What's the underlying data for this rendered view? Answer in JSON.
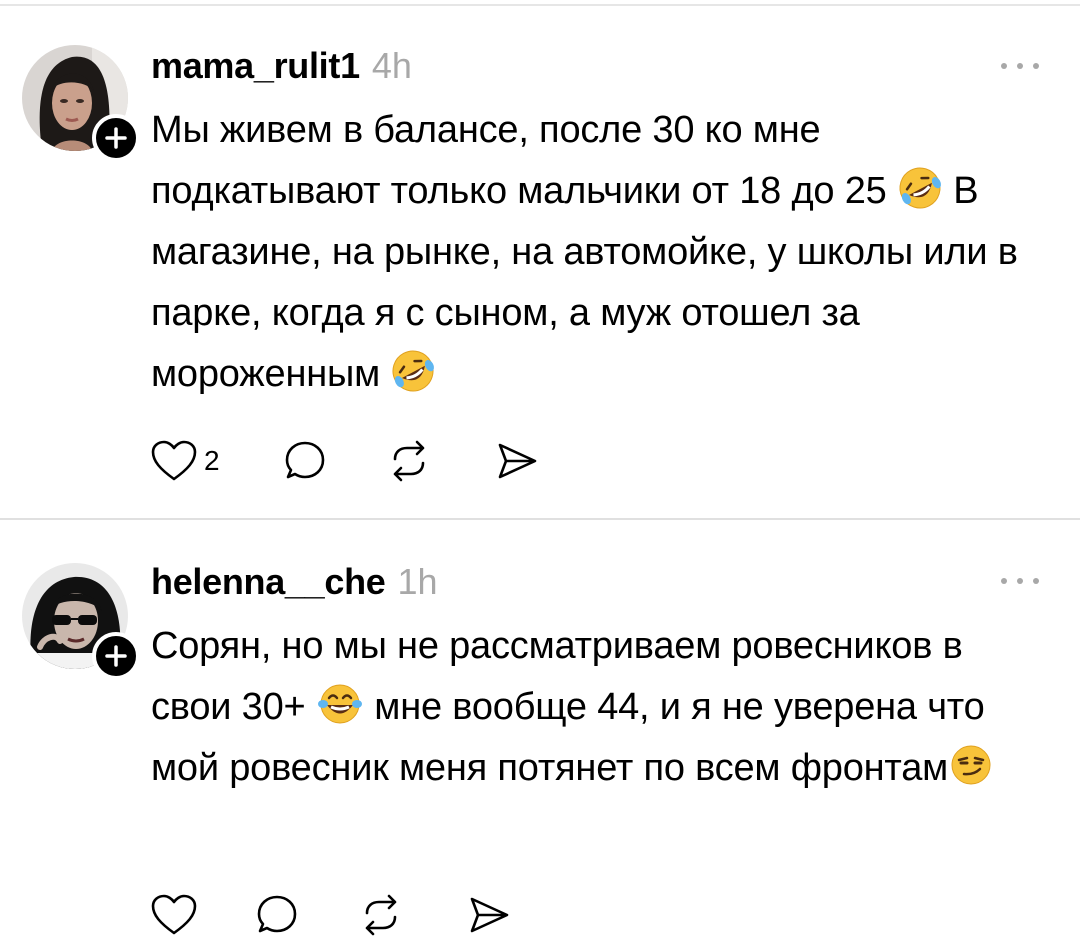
{
  "posts": [
    {
      "username": "mama_rulit1",
      "time": "4h",
      "text_parts": [
        "Мы живем в балансе, после 30 ко мне подкатывают только мальчики от 18 до 25 ",
        " В магазине, на рынке, на автомойке, у школы или в парке, когда я с сыном, а муж отошел за мороженным "
      ],
      "emojis": [
        "rolling-laughing-emoji",
        "rolling-laughing-emoji"
      ],
      "like_count": "2"
    },
    {
      "username": "helenna__che",
      "time": "1h",
      "text_parts": [
        "Сорян, но мы не рассматриваем ровесников в свои 30+ ",
        " мне вообще 44, и я не уверена что мой ровесник меня потянет по всем фронтам"
      ],
      "emojis": [
        "tears-of-joy-emoji",
        "smirk-emoji"
      ],
      "like_count": ""
    }
  ],
  "colors": {
    "text": "#000000",
    "muted": "#a8a8a8",
    "divider": "#e0e0e0",
    "emoji_yellow": "#f8c33a"
  }
}
